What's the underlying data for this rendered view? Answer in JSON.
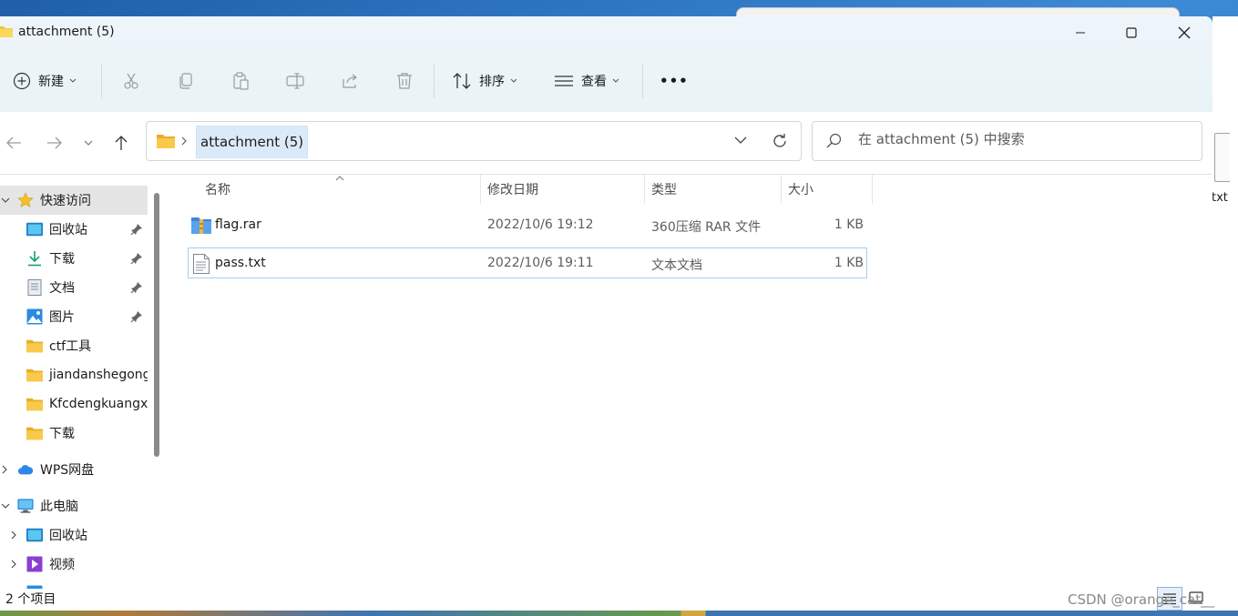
{
  "window": {
    "title": "attachment (5)",
    "controls": {
      "minimize": "—",
      "maximize": "□",
      "close": "✕"
    }
  },
  "toolbar": {
    "new_label": "新建",
    "sort_label": "排序",
    "view_label": "查看",
    "more_label": "•••",
    "icons": [
      "plus-circle-icon",
      "cut-icon",
      "copy-icon",
      "paste-icon",
      "rename-icon",
      "share-icon",
      "delete-icon",
      "sort-icon",
      "view-icon",
      "more-icon"
    ]
  },
  "address_bar": {
    "crumb": "attachment (5)",
    "search_placeholder": "在 attachment (5) 中搜索"
  },
  "sidebar": {
    "quick_access": "快速访问",
    "items": [
      {
        "label": "回收站",
        "icon": "recycle-bin-icon",
        "pinned": true
      },
      {
        "label": "下载",
        "icon": "download-icon",
        "pinned": true
      },
      {
        "label": "文档",
        "icon": "document-icon",
        "pinned": true
      },
      {
        "label": "图片",
        "icon": "pictures-icon",
        "pinned": true
      },
      {
        "label": "ctf工具",
        "icon": "folder-icon",
        "pinned": false
      },
      {
        "label": "jiandanshegong",
        "icon": "folder-icon",
        "pinned": false
      },
      {
        "label": "Kfcdengkuangxi",
        "icon": "folder-icon",
        "pinned": false
      },
      {
        "label": "下载",
        "icon": "folder-icon",
        "pinned": false
      }
    ],
    "wps": "WPS网盘",
    "this_pc": "此电脑",
    "pc_items": [
      {
        "label": "回收站",
        "icon": "recycle-bin-icon"
      },
      {
        "label": "视频",
        "icon": "video-icon"
      }
    ]
  },
  "columns": {
    "name": "名称",
    "modified": "修改日期",
    "type": "类型",
    "size": "大小"
  },
  "files": [
    {
      "name": "flag.rar",
      "modified": "2022/10/6 19:12",
      "type": "360压缩 RAR 文件",
      "size": "1 KB",
      "icon": "rar-archive-icon"
    },
    {
      "name": "pass.txt",
      "modified": "2022/10/6 19:11",
      "type": "文本文档",
      "size": "1 KB",
      "icon": "text-file-icon"
    }
  ],
  "status": {
    "count": "2 个项目"
  },
  "desktop": {
    "file_label": "txt"
  },
  "watermark": "CSDN @orange_cat__",
  "colors": {
    "accent": "#0067c0",
    "folder": "#f4c443",
    "selection": "#a8cdf0"
  }
}
